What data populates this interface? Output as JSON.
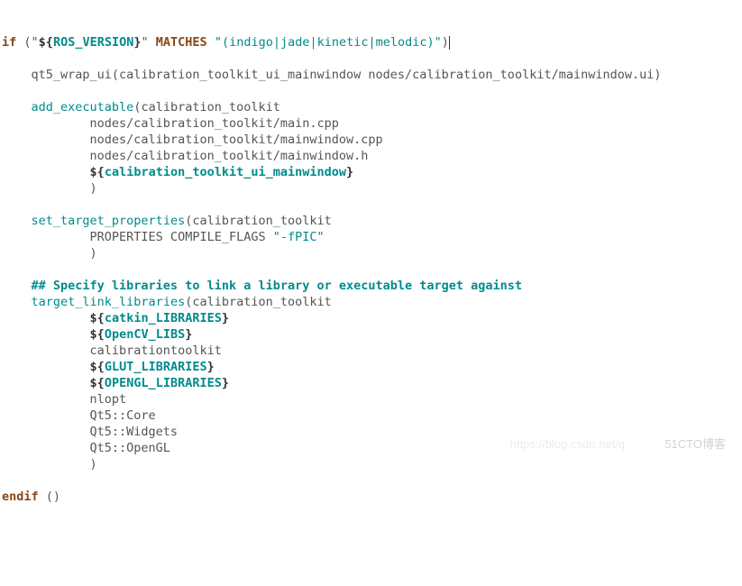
{
  "code": {
    "l1_if": "if",
    "l1_open": " (",
    "l1_q1": "\"",
    "l1_db": "${",
    "l1_var": "ROS_VERSION",
    "l1_de": "}",
    "l1_q2": "\"",
    "l1_sp": " ",
    "l1_matches": "MATCHES",
    "l1_sp2": " ",
    "l1_str": "\"(indigo|jade|kinetic|melodic)\"",
    "l1_close": ")",
    "l3": "    qt5_wrap_ui(calibration_toolkit_ui_mainwindow nodes/calibration_toolkit/mainwindow.ui)",
    "l5_func": "add_executable",
    "l5_args": "(calibration_toolkit",
    "l6": "            nodes/calibration_toolkit/main.cpp",
    "l7": "            nodes/calibration_toolkit/mainwindow.cpp",
    "l8": "            nodes/calibration_toolkit/mainwindow.h",
    "l9_pre": "            ",
    "l9_db": "${",
    "l9_var": "calibration_toolkit_ui_mainwindow",
    "l9_de": "}",
    "l10": "            )",
    "l12_func": "set_target_properties",
    "l12_args": "(calibration_toolkit",
    "l13_pre": "            PROPERTIES COMPILE_FLAGS ",
    "l13_str": "\"-fPIC\"",
    "l14": "            )",
    "l16": "    ## Specify libraries to link a library or executable target against",
    "l17_func": "target_link_libraries",
    "l17_args": "(calibration_toolkit",
    "l18_pre": "            ",
    "l18_db": "${",
    "l18_var": "catkin_LIBRARIES",
    "l18_de": "}",
    "l19_pre": "            ",
    "l19_db": "${",
    "l19_var": "OpenCV_LIBS",
    "l19_de": "}",
    "l20": "            calibrationtoolkit",
    "l21_pre": "            ",
    "l21_db": "${",
    "l21_var": "GLUT_LIBRARIES",
    "l21_de": "}",
    "l22_pre": "            ",
    "l22_db": "${",
    "l22_var": "OPENGL_LIBRARIES",
    "l22_de": "}",
    "l23": "            nlopt",
    "l24": "            Qt5::Core",
    "l25": "            Qt5::Widgets",
    "l26": "            Qt5::OpenGL",
    "l27": "            )",
    "l28_endif": "endif",
    "l28_args": " ()"
  },
  "watermark1": "https://blog.csdn.net/q",
  "watermark2": "51CTO博客"
}
